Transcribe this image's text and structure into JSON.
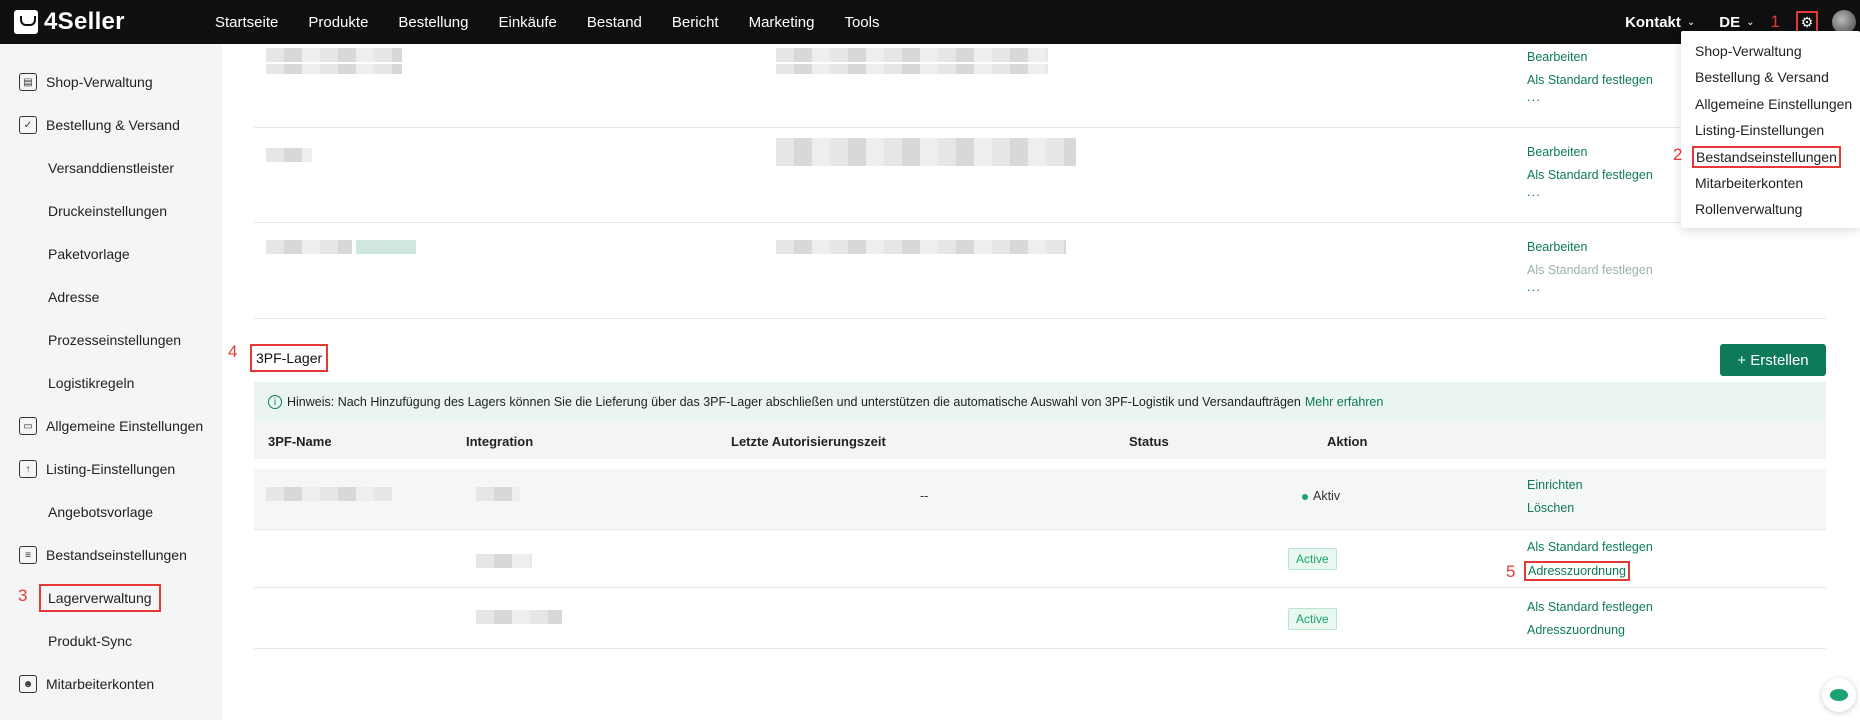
{
  "app": {
    "logo_text": "4Seller"
  },
  "nav": {
    "items": [
      "Startseite",
      "Produkte",
      "Bestellung",
      "Einkäufe",
      "Bestand",
      "Bericht",
      "Marketing",
      "Tools"
    ],
    "contact": "Kontakt",
    "lang": "DE"
  },
  "annotations": {
    "a1": "1",
    "a2": "2",
    "a3": "3",
    "a4": "4",
    "a5": "5"
  },
  "dropdown": {
    "items": [
      "Shop-Verwaltung",
      "Bestellung & Versand",
      "Allgemeine Einstellungen",
      "Listing-Einstellungen",
      "Bestandseinstellungen",
      "Mitarbeiterkonten",
      "Rollenverwaltung"
    ]
  },
  "sidebar": {
    "items": [
      {
        "label": "Shop-Verwaltung",
        "icon": "store-icon"
      },
      {
        "label": "Bestellung & Versand",
        "icon": "order-icon"
      },
      {
        "label": "Versanddienstleister"
      },
      {
        "label": "Druckeinstellungen"
      },
      {
        "label": "Paketvorlage"
      },
      {
        "label": "Adresse"
      },
      {
        "label": "Prozesseinstellungen"
      },
      {
        "label": "Logistikregeln"
      },
      {
        "label": "Allgemeine Einstellungen",
        "icon": "printer-icon"
      },
      {
        "label": "Listing-Einstellungen",
        "icon": "upload-icon"
      },
      {
        "label": "Angebotsvorlage"
      },
      {
        "label": "Bestandseinstellungen",
        "icon": "inventory-icon"
      },
      {
        "label": "Lagerverwaltung"
      },
      {
        "label": "Produkt-Sync"
      },
      {
        "label": "Mitarbeiterkonten",
        "icon": "user-badge-icon"
      }
    ]
  },
  "upper_rows": {
    "edit": "Bearbeiten",
    "set_default": "Als Standard festlegen",
    "more": "..."
  },
  "section": {
    "title": "3PF-Lager",
    "create_button": "+ Erstellen",
    "hint": "Hinweis: Nach Hinzufügung des Lagers können Sie die Lieferung über das 3PF-Lager abschließen und unterstützen die automatische Auswahl von 3PF-Logistik und Versandaufträgen",
    "hint_link": "Mehr erfahren"
  },
  "table": {
    "headers": [
      "3PF-Name",
      "Integration",
      "Letzte Autorisierungszeit",
      "Status",
      "Aktion"
    ],
    "rows": [
      {
        "time": "--",
        "status": "Aktiv",
        "actions": [
          "Einrichten",
          "Löschen"
        ]
      },
      {
        "time": "",
        "status": "Active",
        "actions": [
          "Als Standard festlegen",
          "Adresszuordnung"
        ]
      },
      {
        "time": "",
        "status": "Active",
        "actions": [
          "Als Standard festlegen",
          "Adresszuordnung"
        ]
      }
    ]
  },
  "colors": {
    "accent": "#0e7a59",
    "annotation": "#e53935",
    "topbar": "#0f0f0f"
  }
}
